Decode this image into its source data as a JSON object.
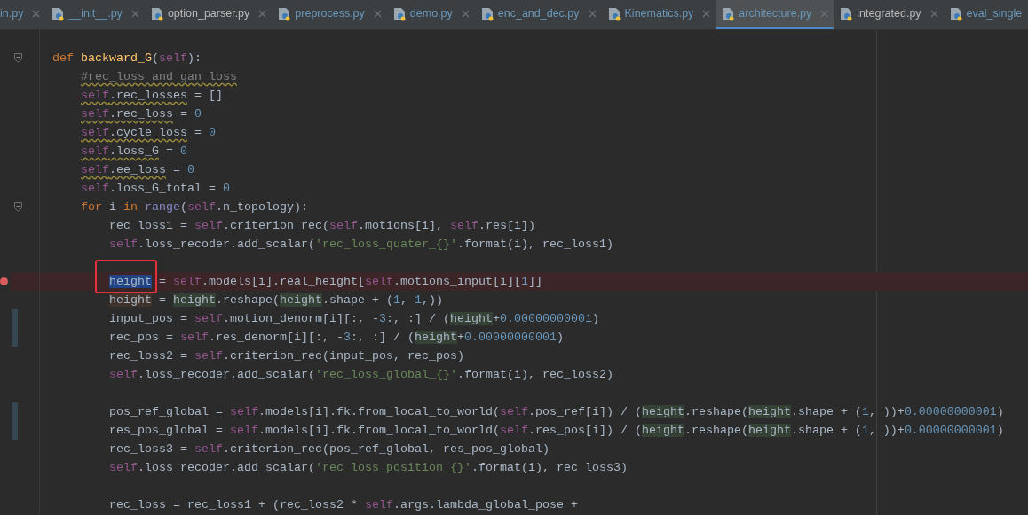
{
  "tabs": [
    {
      "label": "in.py",
      "selected": false,
      "modified": true,
      "clipped_left": true
    },
    {
      "label": "__init__.py",
      "selected": false,
      "modified": true
    },
    {
      "label": "option_parser.py",
      "selected": false,
      "modified": false
    },
    {
      "label": "preprocess.py",
      "selected": false,
      "modified": true
    },
    {
      "label": "demo.py",
      "selected": false,
      "modified": true
    },
    {
      "label": "enc_and_dec.py",
      "selected": false,
      "modified": true
    },
    {
      "label": "Kinematics.py",
      "selected": false,
      "modified": true
    },
    {
      "label": "architecture.py",
      "selected": true,
      "modified": true
    },
    {
      "label": "integrated.py",
      "selected": false,
      "modified": false
    },
    {
      "label": "eval_single",
      "selected": false,
      "modified": true,
      "clipped_right": true
    }
  ],
  "editor": {
    "lines": [
      {
        "kind": "fold",
        "blank_before": true,
        "segments": [
          {
            "text": "def ",
            "kind": "keyword"
          },
          {
            "text": "backward_G",
            "kind": "function"
          },
          {
            "text": "(",
            "kind": "plain"
          },
          {
            "text": "self",
            "kind": "self"
          },
          {
            "text": "):",
            "kind": "plain"
          }
        ],
        "children": [
          {
            "kind": "plain",
            "segments": [
              {
                "text": "#rec_loss and gan loss",
                "kind": "comment",
                "wavy": true
              }
            ]
          },
          {
            "kind": "plain",
            "segments": [
              {
                "text": "self",
                "kind": "self",
                "wavy": true
              },
              {
                "text": ".rec_losses",
                "kind": "plain",
                "wavy": true
              },
              {
                "text": " = []",
                "kind": "plain"
              }
            ]
          },
          {
            "kind": "plain",
            "segments": [
              {
                "text": "self",
                "kind": "self",
                "wavy": true
              },
              {
                "text": ".rec_loss",
                "kind": "plain",
                "wavy": true
              },
              {
                "text": " = ",
                "kind": "plain"
              },
              {
                "text": "0",
                "kind": "number"
              }
            ]
          },
          {
            "kind": "plain",
            "segments": [
              {
                "text": "self",
                "kind": "self",
                "wavy": true
              },
              {
                "text": ".cycle_loss",
                "kind": "plain",
                "wavy": true
              },
              {
                "text": " = ",
                "kind": "plain"
              },
              {
                "text": "0",
                "kind": "number"
              }
            ]
          },
          {
            "kind": "plain",
            "segments": [
              {
                "text": "self",
                "kind": "self",
                "wavy": true
              },
              {
                "text": ".loss_G",
                "kind": "plain",
                "wavy": true
              },
              {
                "text": " = ",
                "kind": "plain"
              },
              {
                "text": "0",
                "kind": "number"
              }
            ]
          },
          {
            "kind": "plain",
            "segments": [
              {
                "text": "self",
                "kind": "self",
                "wavy": true
              },
              {
                "text": ".ee_loss",
                "kind": "plain",
                "wavy": true
              },
              {
                "text": " = ",
                "kind": "plain"
              },
              {
                "text": "0",
                "kind": "number"
              }
            ]
          },
          {
            "kind": "plain",
            "segments": [
              {
                "text": "self",
                "kind": "self"
              },
              {
                "text": ".loss_G_total = ",
                "kind": "plain"
              },
              {
                "text": "0",
                "kind": "number"
              }
            ]
          },
          {
            "kind": "fold",
            "segments": [
              {
                "text": "for",
                "kind": "keyword"
              },
              {
                "text": " i ",
                "kind": "plain"
              },
              {
                "text": "in ",
                "kind": "keyword"
              },
              {
                "text": "range",
                "kind": "builtin"
              },
              {
                "text": "(",
                "kind": "plain"
              },
              {
                "text": "self",
                "kind": "self"
              },
              {
                "text": ".n_topology):",
                "kind": "plain"
              }
            ],
            "children": [
              {
                "kind": "plain",
                "segments": [
                  {
                    "text": "rec_loss1 = ",
                    "kind": "plain"
                  },
                  {
                    "text": "self",
                    "kind": "self"
                  },
                  {
                    "text": ".criterion_rec(",
                    "kind": "plain"
                  },
                  {
                    "text": "self",
                    "kind": "self"
                  },
                  {
                    "text": ".motions[i], ",
                    "kind": "plain"
                  },
                  {
                    "text": "self",
                    "kind": "self"
                  },
                  {
                    "text": ".res[i])",
                    "kind": "plain"
                  }
                ]
              },
              {
                "kind": "plain",
                "segments": [
                  {
                    "text": "self",
                    "kind": "self"
                  },
                  {
                    "text": ".loss_recoder.add_scalar(",
                    "kind": "plain"
                  },
                  {
                    "text": "'rec_loss_quater_{}'",
                    "kind": "string"
                  },
                  {
                    "text": ".format(i), rec_loss1)",
                    "kind": "plain"
                  }
                ]
              },
              {
                "kind": "breakpoint",
                "blank_before": true,
                "segments": [
                  {
                    "text": "height",
                    "kind": "selection",
                    "framed": true
                  },
                  {
                    "text": " = ",
                    "kind": "plain"
                  },
                  {
                    "text": "self",
                    "kind": "self"
                  },
                  {
                    "text": ".models[i].real_height[",
                    "kind": "plain"
                  },
                  {
                    "text": "self",
                    "kind": "self"
                  },
                  {
                    "text": ".motions_input[i][",
                    "kind": "plain"
                  },
                  {
                    "text": "1",
                    "kind": "number"
                  },
                  {
                    "text": "]]",
                    "kind": "plain"
                  }
                ]
              },
              {
                "kind": "plain",
                "segments": [
                  {
                    "text": "height",
                    "kind": "write_usage"
                  },
                  {
                    "text": " = ",
                    "kind": "plain"
                  },
                  {
                    "text": "height",
                    "kind": "usage"
                  },
                  {
                    "text": ".reshape(",
                    "kind": "plain"
                  },
                  {
                    "text": "height",
                    "kind": "usage"
                  },
                  {
                    "text": ".shape + (",
                    "kind": "plain"
                  },
                  {
                    "text": "1",
                    "kind": "number"
                  },
                  {
                    "text": ", ",
                    "kind": "plain"
                  },
                  {
                    "text": "1",
                    "kind": "number"
                  },
                  {
                    "text": ",))",
                    "kind": "plain"
                  }
                ]
              },
              {
                "kind": "changed",
                "segments": [
                  {
                    "text": "input_pos = ",
                    "kind": "plain"
                  },
                  {
                    "text": "self",
                    "kind": "self"
                  },
                  {
                    "text": ".motion_denorm[i][:, -",
                    "kind": "plain"
                  },
                  {
                    "text": "3",
                    "kind": "number"
                  },
                  {
                    "text": ":, :] / (",
                    "kind": "plain"
                  },
                  {
                    "text": "height",
                    "kind": "usage"
                  },
                  {
                    "text": "+",
                    "kind": "plain"
                  },
                  {
                    "text": "0.00000000001",
                    "kind": "number"
                  },
                  {
                    "text": ")",
                    "kind": "plain"
                  }
                ]
              },
              {
                "kind": "changed",
                "segments": [
                  {
                    "text": "rec_pos = ",
                    "kind": "plain"
                  },
                  {
                    "text": "self",
                    "kind": "self"
                  },
                  {
                    "text": ".res_denorm[i][:, -",
                    "kind": "plain"
                  },
                  {
                    "text": "3",
                    "kind": "number"
                  },
                  {
                    "text": ":, :] / (",
                    "kind": "plain"
                  },
                  {
                    "text": "height",
                    "kind": "usage"
                  },
                  {
                    "text": "+",
                    "kind": "plain"
                  },
                  {
                    "text": "0.00000000001",
                    "kind": "number"
                  },
                  {
                    "text": ")",
                    "kind": "plain"
                  }
                ]
              },
              {
                "kind": "plain",
                "segments": [
                  {
                    "text": "rec_loss2 = ",
                    "kind": "plain"
                  },
                  {
                    "text": "self",
                    "kind": "self"
                  },
                  {
                    "text": ".criterion_rec(input_pos, rec_pos)",
                    "kind": "plain"
                  }
                ]
              },
              {
                "kind": "plain",
                "segments": [
                  {
                    "text": "self",
                    "kind": "self"
                  },
                  {
                    "text": ".loss_recoder.add_scalar(",
                    "kind": "plain"
                  },
                  {
                    "text": "'rec_loss_global_{}'",
                    "kind": "string"
                  },
                  {
                    "text": ".format(i), rec_loss2)",
                    "kind": "plain"
                  }
                ]
              },
              {
                "kind": "changed",
                "blank_before": true,
                "segments": [
                  {
                    "text": "pos_ref_global = ",
                    "kind": "plain"
                  },
                  {
                    "text": "self",
                    "kind": "self"
                  },
                  {
                    "text": ".models[i].fk.from_local_to_world(",
                    "kind": "plain"
                  },
                  {
                    "text": "self",
                    "kind": "self"
                  },
                  {
                    "text": ".pos_ref[i]) / (",
                    "kind": "plain"
                  },
                  {
                    "text": "height",
                    "kind": "usage"
                  },
                  {
                    "text": ".reshape(",
                    "kind": "plain"
                  },
                  {
                    "text": "height",
                    "kind": "usage"
                  },
                  {
                    "text": ".shape + (",
                    "kind": "plain"
                  },
                  {
                    "text": "1",
                    "kind": "number"
                  },
                  {
                    "text": ", ))+",
                    "kind": "plain"
                  },
                  {
                    "text": "0.00000000001",
                    "kind": "number"
                  },
                  {
                    "text": ")",
                    "kind": "plain"
                  }
                ]
              },
              {
                "kind": "changed",
                "segments": [
                  {
                    "text": "res_pos_global = ",
                    "kind": "plain"
                  },
                  {
                    "text": "self",
                    "kind": "self"
                  },
                  {
                    "text": ".models[i].fk.from_local_to_world(",
                    "kind": "plain"
                  },
                  {
                    "text": "self",
                    "kind": "self"
                  },
                  {
                    "text": ".res_pos[i]) / (",
                    "kind": "plain"
                  },
                  {
                    "text": "height",
                    "kind": "usage"
                  },
                  {
                    "text": ".reshape(",
                    "kind": "plain"
                  },
                  {
                    "text": "height",
                    "kind": "usage"
                  },
                  {
                    "text": ".shape + (",
                    "kind": "plain"
                  },
                  {
                    "text": "1",
                    "kind": "number"
                  },
                  {
                    "text": ", ))+",
                    "kind": "plain"
                  },
                  {
                    "text": "0.00000000001",
                    "kind": "number"
                  },
                  {
                    "text": ")",
                    "kind": "plain"
                  }
                ]
              },
              {
                "kind": "plain",
                "segments": [
                  {
                    "text": "rec_loss3 = ",
                    "kind": "plain"
                  },
                  {
                    "text": "self",
                    "kind": "self"
                  },
                  {
                    "text": ".criterion_rec(pos_ref_global, res_pos_global)",
                    "kind": "plain"
                  }
                ]
              },
              {
                "kind": "plain",
                "segments": [
                  {
                    "text": "self",
                    "kind": "self"
                  },
                  {
                    "text": ".loss_recoder.add_scalar(",
                    "kind": "plain"
                  },
                  {
                    "text": "'rec_loss_position_{}'",
                    "kind": "string"
                  },
                  {
                    "text": ".format(i), rec_loss3)",
                    "kind": "plain"
                  }
                ]
              },
              {
                "kind": "plain",
                "blank_before": true,
                "segments": [
                  {
                    "text": "rec_loss = rec_loss1 + (rec_loss2 * ",
                    "kind": "plain"
                  },
                  {
                    "text": "self",
                    "kind": "self"
                  },
                  {
                    "text": ".args.lambda_global_pose +",
                    "kind": "plain"
                  }
                ]
              }
            ]
          }
        ]
      }
    ]
  }
}
